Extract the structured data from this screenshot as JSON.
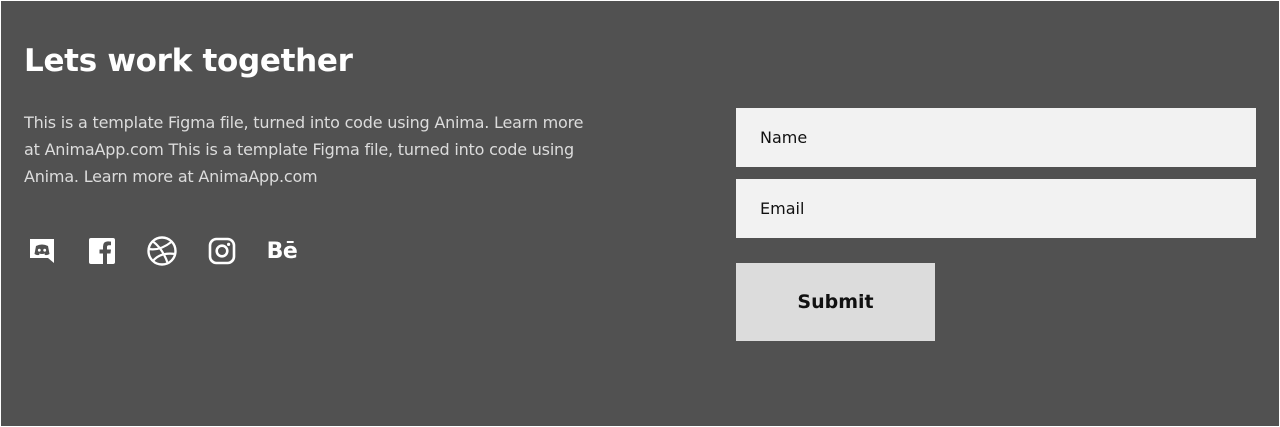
{
  "contact": {
    "title": "Lets work together",
    "description": "This is a template Figma file, turned into code using Anima. Learn more at AnimaApp.com This is a template Figma file, turned into code using Anima. Learn more at AnimaApp.com"
  },
  "socials": [
    {
      "name": "discord",
      "icon": "discord-icon"
    },
    {
      "name": "facebook",
      "icon": "facebook-icon"
    },
    {
      "name": "dribbble",
      "icon": "dribbble-icon"
    },
    {
      "name": "instagram",
      "icon": "instagram-icon"
    },
    {
      "name": "behance",
      "icon": "behance-icon",
      "text": "Bē"
    }
  ],
  "form": {
    "name_placeholder": "Name",
    "email_placeholder": "Email",
    "submit_label": "Submit"
  },
  "colors": {
    "background": "#515151",
    "text": "#ffffff",
    "muted_text": "#dcdcdc",
    "field_bg": "#f2f2f2",
    "button_bg": "#dcdcdc"
  }
}
